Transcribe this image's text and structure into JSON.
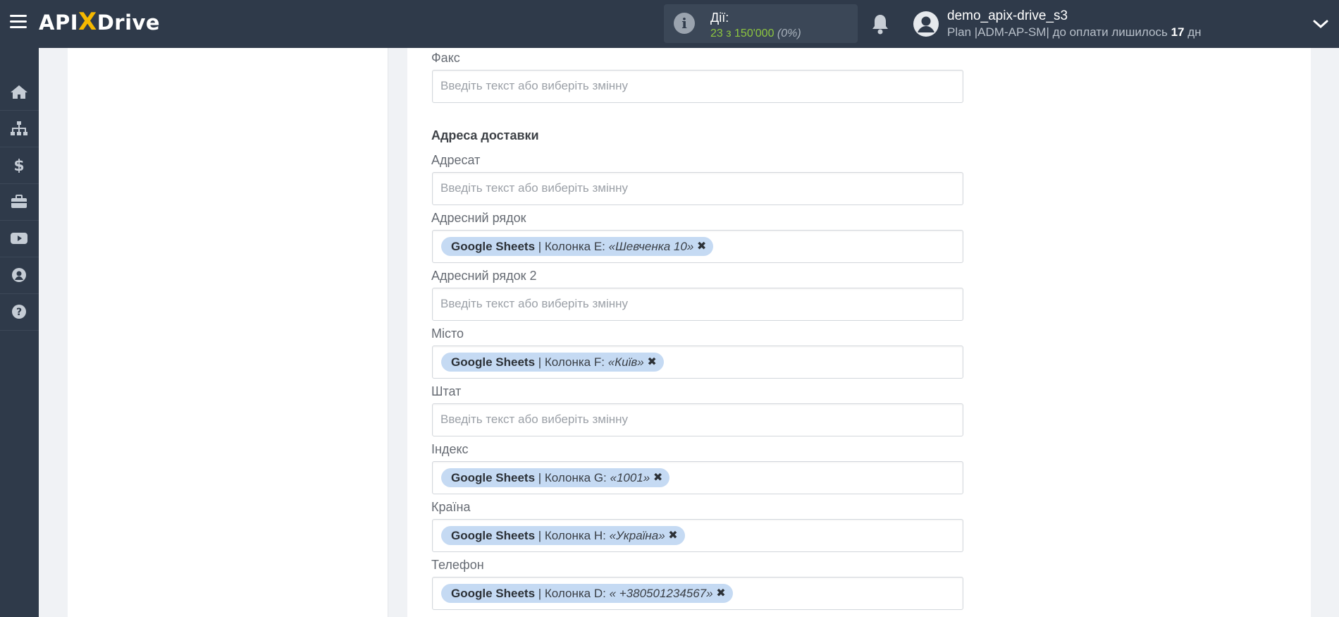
{
  "header": {
    "logo_left": "API",
    "logo_x": "X",
    "logo_right": "Drive",
    "actions_label": "Дії:",
    "actions_count": "23 з 150'000",
    "actions_percent": "(0%)",
    "user_name": "demo_apix-drive_s3",
    "plan_prefix": "Plan |ADM-AP-SM| до оплати лишилось",
    "plan_days": "17",
    "plan_suffix": "дн"
  },
  "sidebar": {
    "items": [
      "home-icon",
      "sitemap-icon",
      "dollar-icon",
      "briefcase-icon",
      "youtube-icon",
      "user-circle-icon",
      "help-icon"
    ]
  },
  "form": {
    "placeholder": "Введіть текст або виберіть змінну",
    "fax_label": "Факс",
    "section_title": "Адреса доставки",
    "recipient_label": "Адресат",
    "address_label": "Адресний рядок",
    "address_chip": {
      "source": "Google Sheets",
      "column": "| Колонка E:",
      "value": "«Шевченка 10»"
    },
    "address2_label": "Адресний рядок 2",
    "city_label": "Місто",
    "city_chip": {
      "source": "Google Sheets",
      "column": "| Колонка F:",
      "value": "«Київ»"
    },
    "state_label": "Штат",
    "zip_label": "Індекс",
    "zip_chip": {
      "source": "Google Sheets",
      "column": "| Колонка G:",
      "value": "«1001»"
    },
    "country_label": "Країна",
    "country_chip": {
      "source": "Google Sheets",
      "column": "| Колонка H:",
      "value": "«Україна»"
    },
    "phone_label": "Телефон",
    "phone_chip": {
      "source": "Google Sheets",
      "column": "| Колонка D:",
      "value": "« +380501234567»"
    },
    "chip_close": "✖"
  },
  "colors": {
    "topbar": "#2f3a4a",
    "accent_green": "#8dc63f",
    "logo_x": "#f5b800",
    "chip_bg": "#c5daf3"
  }
}
